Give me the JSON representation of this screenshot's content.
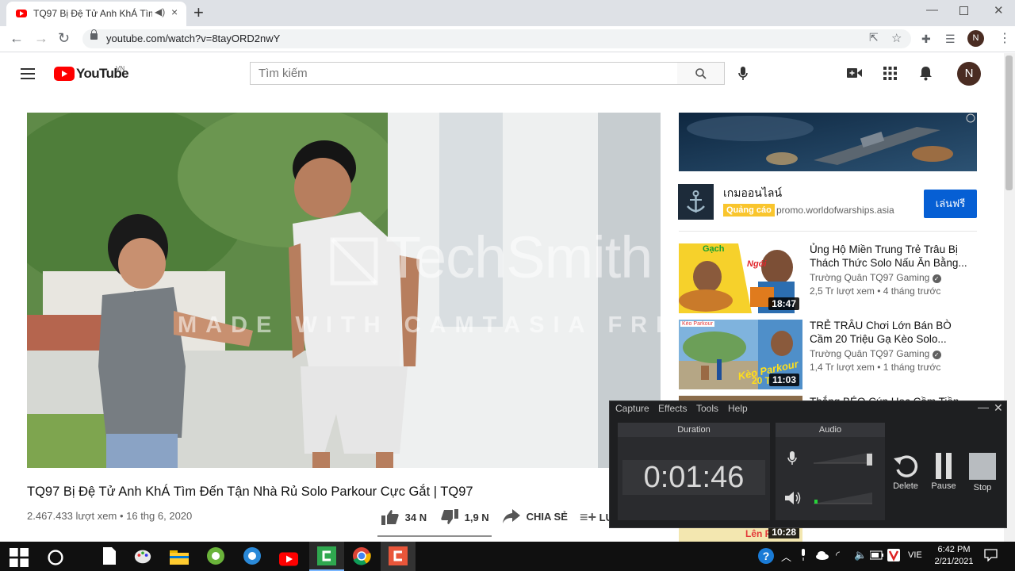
{
  "browser": {
    "tab_title": "TQ97 Bị Đệ Tử Anh KhÁ Tìm",
    "tab_close": "×",
    "new_tab": "+",
    "url": "youtube.com/watch?v=8tayORD2nwY",
    "profile_initial": "N"
  },
  "youtube": {
    "logo_text": "YouTube",
    "country": "VN",
    "search_placeholder": "Tìm kiếm",
    "avatar_initial": "N"
  },
  "video": {
    "watermark_main": "TechSmith",
    "watermark_sub": "MADE WITH CAMTASIA FREE TRIAL",
    "title": "TQ97 Bị Đệ Tử Anh KhÁ Tìm Đến Tận Nhà Rủ Solo Parkour Cực Gắt | TQ97",
    "views": "2.467.433 lượt xem",
    "date": "16 thg 6, 2020",
    "likes": "34 N",
    "dislikes": "1,9 N",
    "share": "CHIA SẺ",
    "save": "LƯ"
  },
  "ad": {
    "name": "เกมออนไลน์",
    "tag": "Quảng cáo",
    "domain": "promo.worldofwarships.asia",
    "button": "เล่นฟรี"
  },
  "related": [
    {
      "title": "Ủng Hộ Miền Trung Trẻ Trâu Bị Thách Thức Solo Nấu Ăn Bằng...",
      "channel": "Trường Quân TQ97 Gaming",
      "meta": "2,5 Tr lượt xem • 4 tháng trước",
      "duration": "18:47",
      "thumb_text_1": "Gạch",
      "thumb_text_2": "Ngói"
    },
    {
      "title": "TRẺ TRÂU Chơi Lớn Bán BÒ Cầm 20 Triệu Gạ Kèo Solo...",
      "channel": "Trường Quân TQ97 Gaming",
      "meta": "1,4 Tr lượt xem • 1 tháng trước",
      "duration": "11:03",
      "thumb_text_1": "Kèo Parkour",
      "thumb_text_2": "20 T"
    },
    {
      "title": "Thắng BÉO Cún Học Cầm Tiền",
      "duration": "10:28",
      "thumb_text_1": "Lên F"
    }
  ],
  "camtasia": {
    "menu": [
      "Capture",
      "Effects",
      "Tools",
      "Help"
    ],
    "duration_label": "Duration",
    "audio_label": "Audio",
    "time": "0:01:46",
    "delete": "Delete",
    "pause": "Pause",
    "stop": "Stop",
    "audio_level": 0.03
  },
  "taskbar": {
    "lang": "VIE",
    "time": "6:42 PM",
    "date": "2/21/2021"
  },
  "colors": {
    "yt_red": "#ff0000",
    "ad_button": "#065fd4",
    "ad_tag": "#f9c52d"
  }
}
